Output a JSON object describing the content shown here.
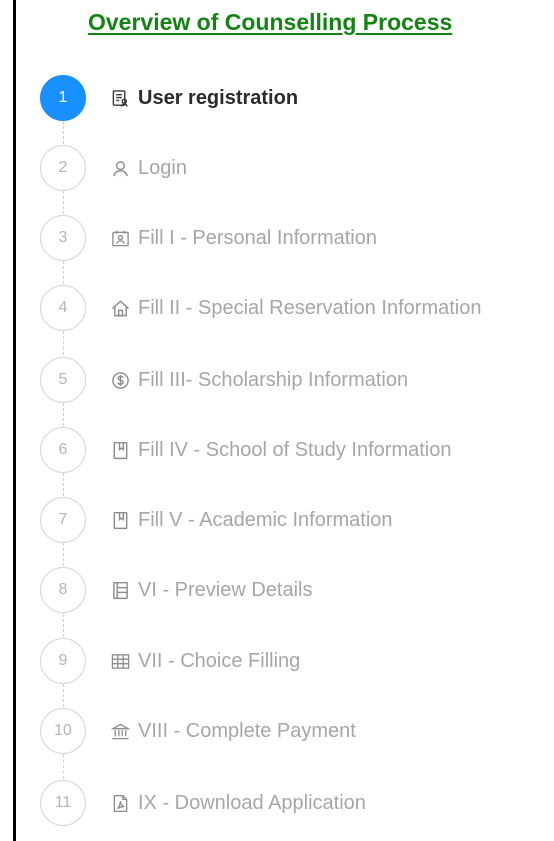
{
  "header": {
    "title": "Overview of Counselling Process"
  },
  "steps": [
    {
      "number": "1",
      "label": "User registration",
      "icon": "registration-form-icon",
      "status": "active"
    },
    {
      "number": "2",
      "label": "Login",
      "icon": "user-icon",
      "status": "pending"
    },
    {
      "number": "3",
      "label": "Fill I - Personal Information",
      "icon": "contact-card-icon",
      "status": "pending"
    },
    {
      "number": "4",
      "label": "Fill II - Special Reservation Information",
      "icon": "home-icon",
      "status": "pending"
    },
    {
      "number": "5",
      "label": "Fill III- Scholarship Information",
      "icon": "dollar-circle-icon",
      "status": "pending"
    },
    {
      "number": "6",
      "label": "Fill IV - School of Study Information",
      "icon": "book-icon",
      "status": "pending"
    },
    {
      "number": "7",
      "label": "Fill V - Academic Information",
      "icon": "book-icon",
      "status": "pending"
    },
    {
      "number": "8",
      "label": "VI - Preview Details",
      "icon": "document-list-icon",
      "status": "pending"
    },
    {
      "number": "9",
      "label": "VII - Choice Filling",
      "icon": "table-icon",
      "status": "pending"
    },
    {
      "number": "10",
      "label": "VIII - Complete Payment",
      "icon": "bank-icon",
      "status": "pending"
    },
    {
      "number": "11",
      "label": "IX - Download Application",
      "icon": "pdf-file-icon",
      "status": "pending"
    }
  ],
  "colors": {
    "title": "#128412",
    "active_step": "#1890ff",
    "inactive_text": "#a6a6a6",
    "active_text": "#2b2b2b"
  }
}
